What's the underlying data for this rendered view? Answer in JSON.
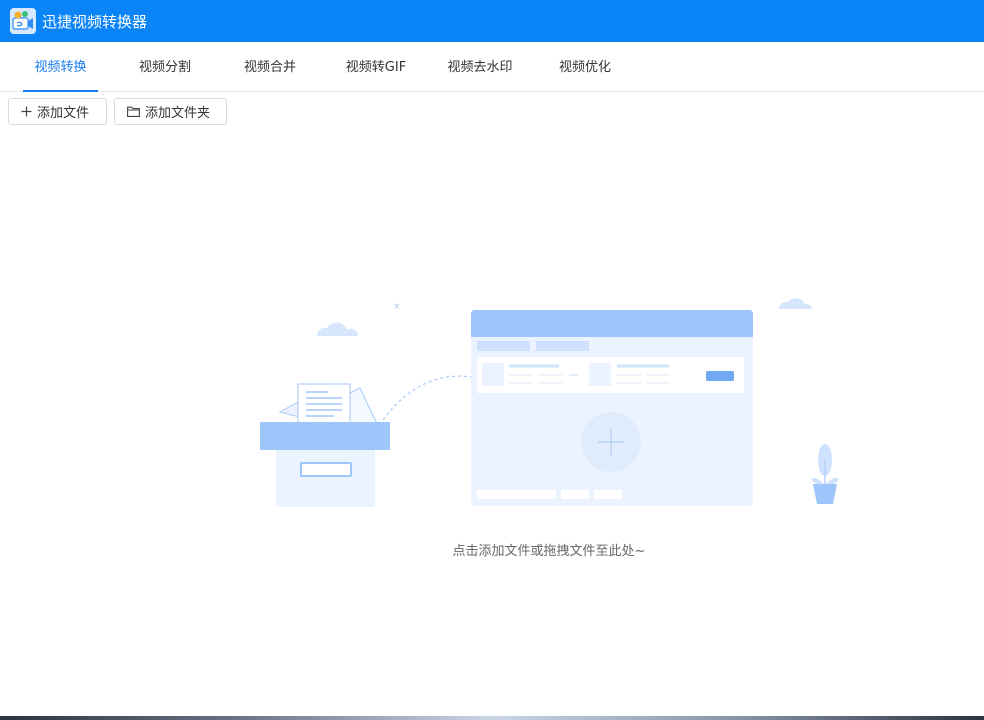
{
  "app": {
    "title": "迅捷视频转换器"
  },
  "tabs": [
    {
      "label": "视频转换",
      "active": true
    },
    {
      "label": "视频分割",
      "active": false
    },
    {
      "label": "视频合并",
      "active": false
    },
    {
      "label": "视频转GIF",
      "active": false
    },
    {
      "label": "视频去水印",
      "active": false
    },
    {
      "label": "视频优化",
      "active": false
    }
  ],
  "toolbar": {
    "add_file_label": "添加文件",
    "add_file_icon": "plus-icon",
    "add_folder_label": "添加文件夹",
    "add_folder_icon": "folder-icon"
  },
  "drop_area": {
    "hint": "点击添加文件或拖拽文件至此处~",
    "illustration_icons": [
      "cloud-icon",
      "file-box-icon",
      "window-icon",
      "plus-icon",
      "plant-icon"
    ]
  },
  "colors": {
    "titlebar": "#0a84f6",
    "accent": "#1a7cf0",
    "illustration_primary": "#9fc6fb",
    "illustration_light": "#eaf3ff"
  }
}
